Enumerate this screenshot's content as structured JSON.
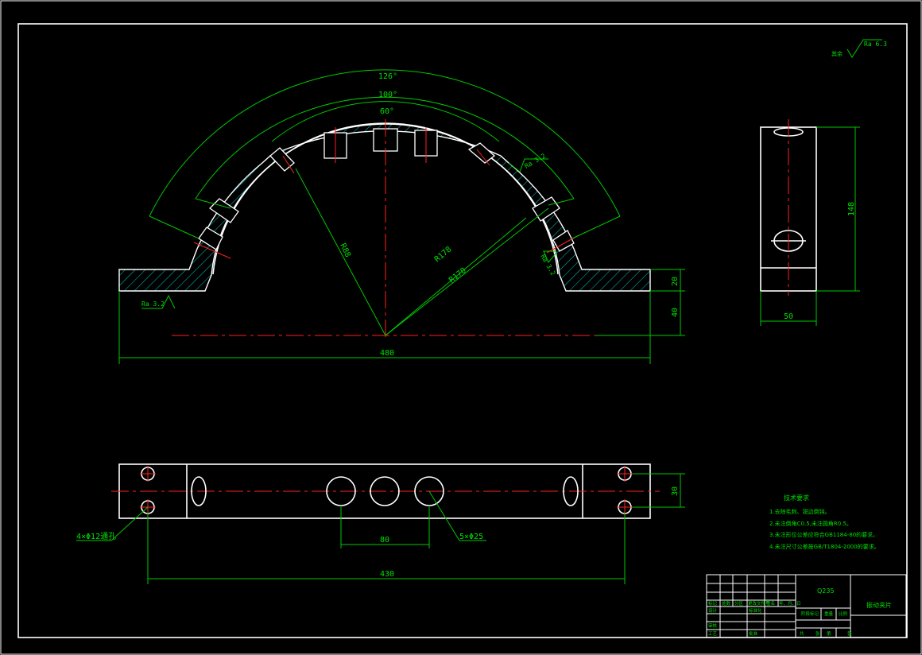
{
  "drawing": {
    "front_view": {
      "angle_outer": "126°",
      "angle_middle": "100°",
      "angle_inner": "60°",
      "radius_1": "R88",
      "radius_2": "R178",
      "radius_3": "R170",
      "roughness_top": "Ra 3.2",
      "roughness_right": "Ra 3.2",
      "roughness_left": "Ra 3.2",
      "width": "480",
      "height_1": "20",
      "height_2": "40"
    },
    "side_view": {
      "height": "148",
      "width": "50"
    },
    "bottom_view": {
      "holes_4": "4×Φ12通孔",
      "holes_5": "5×Φ25",
      "pitch": "80",
      "span": "430",
      "depth": "30"
    },
    "roughness_corner": {
      "label": "其余",
      "value": "Ra 6.3"
    },
    "tech_requirements": {
      "title": "技术要求",
      "items": [
        "1.去除毛刺、锐边倒钝。",
        "2.未注倒角C0.5,未注圆角R0.5。",
        "3.未注形位公差应符合GB1184-80的要求。",
        "4.未注尺寸公差按GB/T1804-2000的要求。"
      ]
    },
    "title_block": {
      "material": "Q235",
      "part_name": "振动夹片",
      "row_labels": [
        "标记",
        "处数",
        "分区",
        "更改文件号",
        "签名",
        "年、月、日"
      ],
      "design": "设计",
      "standardize": "标准化",
      "stage_mark": "阶段标记",
      "weight": "重量",
      "scale": "比例",
      "review": "审核",
      "process": "工艺",
      "approve": "批准",
      "sheet": "共",
      "sheet_of": "张",
      "sheet_no": "第"
    }
  }
}
